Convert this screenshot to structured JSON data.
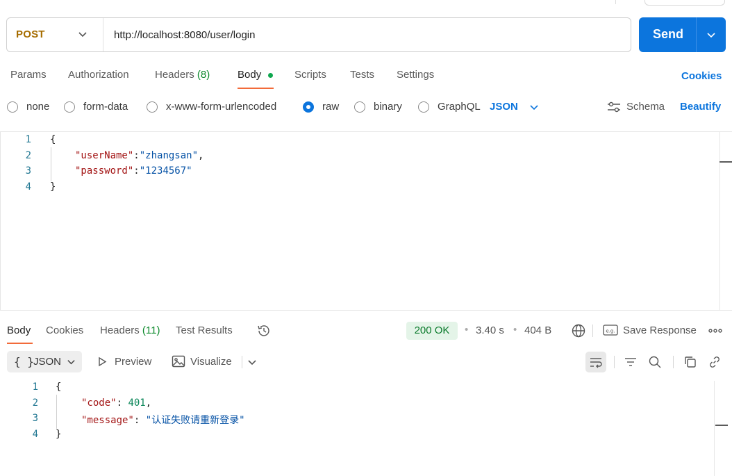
{
  "request": {
    "method": "POST",
    "url": "http://localhost:8080/user/login",
    "send_label": "Send"
  },
  "request_tabs": {
    "params": "Params",
    "authorization": "Authorization",
    "headers": "Headers",
    "headers_count": "(8)",
    "body": "Body",
    "scripts": "Scripts",
    "tests": "Tests",
    "settings": "Settings",
    "cookies": "Cookies"
  },
  "body_options": {
    "none": "none",
    "form_data": "form-data",
    "urlencoded": "x-www-form-urlencoded",
    "raw": "raw",
    "binary": "binary",
    "graphql": "GraphQL",
    "format": "JSON",
    "schema": "Schema",
    "beautify": "Beautify",
    "selected": "raw"
  },
  "request_body": {
    "line_numbers": [
      "1",
      "2",
      "3",
      "4"
    ],
    "open": "{",
    "key1": "\"userName\"",
    "val1": "\"zhangsan\"",
    "key2": "\"password\"",
    "val2": "\"1234567\"",
    "close": "}"
  },
  "response_tabs": {
    "body": "Body",
    "cookies": "Cookies",
    "headers": "Headers",
    "headers_count": "(11)",
    "test_results": "Test Results"
  },
  "response_meta": {
    "status": "200 OK",
    "time": "3.40 s",
    "size": "404 B",
    "save_response": "Save Response",
    "eg_label": "e.g."
  },
  "response_toolbar": {
    "format": "JSON",
    "format_icon": "{ }",
    "preview": "Preview",
    "visualize": "Visualize"
  },
  "response_body": {
    "line_numbers": [
      "1",
      "2",
      "3",
      "4"
    ],
    "open": "{",
    "key1": "\"code\"",
    "val1": "401",
    "key2": "\"message\"",
    "val2": "\"认证失败请重新登录\"",
    "close": "}"
  },
  "colors": {
    "accent": "#0c75dd",
    "method": "#a66d00",
    "status_ok": "#0a7a2b",
    "active_tab_underline": "#f26b3a"
  }
}
